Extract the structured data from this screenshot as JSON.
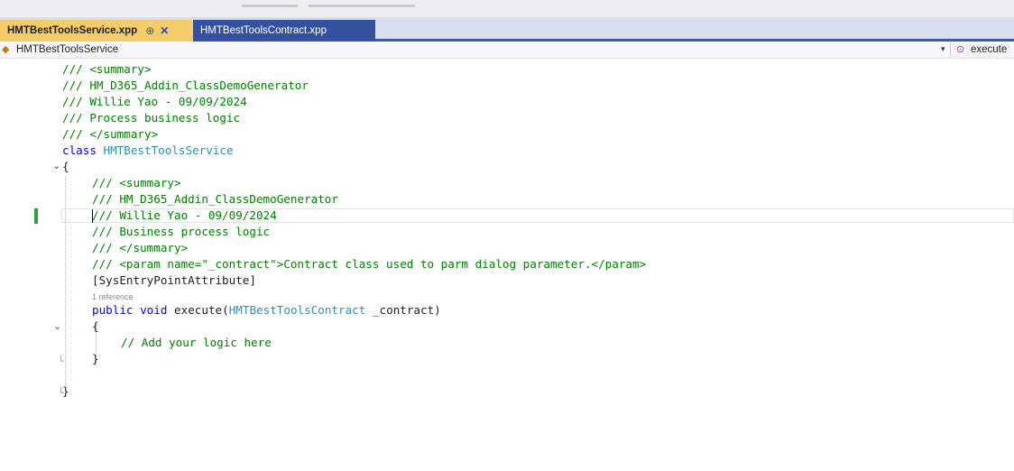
{
  "tabs": [
    {
      "label": "HMTBestToolsService.xpp",
      "pin": "⊕",
      "close": "✕",
      "active": true
    },
    {
      "label": "HMTBestToolsContract.xpp",
      "active": false
    }
  ],
  "navbar": {
    "type_icon": "class-icon",
    "type_label": "HMTBestToolsService",
    "member_icon": "method-icon",
    "member_label": "execute"
  },
  "code": {
    "l1": "/// <summary>",
    "l2": "/// HM_D365_Addin_ClassDemoGenerator",
    "l3": "/// Willie Yao - 09/09/2024",
    "l4": "/// Process business logic",
    "l5": "/// </summary>",
    "l6_kw": "class",
    "l6_name": "HMTBestToolsService",
    "l7": "{",
    "l8": "/// <summary>",
    "l9": "/// HM_D365_Addin_ClassDemoGenerator",
    "l10": "/// Willie Yao - 09/09/2024",
    "l11": "/// Business process logic",
    "l12": "/// </summary>",
    "l13": "/// <param name=\"_contract\">Contract class used to parm dialog parameter.</param>",
    "l14": "[SysEntryPointAttribute]",
    "codelens": "1 reference",
    "l15_kw1": "public",
    "l15_kw2": "void",
    "l15_name": "execute(",
    "l15_type": "HMTBestToolsContract",
    "l15_rest": " _contract)",
    "l16": "{",
    "l17": "// Add your logic here",
    "l18": "}",
    "l19": "}"
  }
}
